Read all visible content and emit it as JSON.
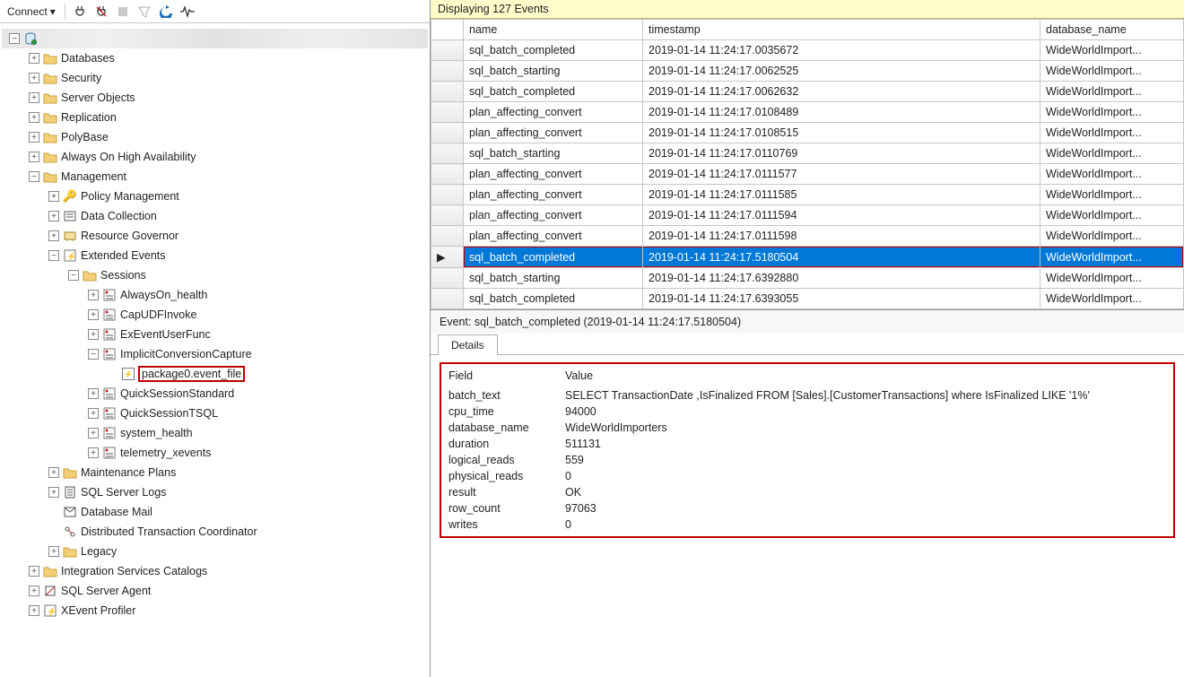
{
  "toolbar": {
    "connect_label": "Connect",
    "icons": [
      "plug",
      "plug-x",
      "stop",
      "filter",
      "refresh",
      "pulse"
    ]
  },
  "tree": {
    "root_label": ".\\",
    "nodes": [
      {
        "level": 0,
        "exp": "-",
        "icon": "db",
        "label": ".\\",
        "blur": true
      },
      {
        "level": 1,
        "exp": "+",
        "icon": "folder",
        "label": "Databases"
      },
      {
        "level": 1,
        "exp": "+",
        "icon": "folder",
        "label": "Security"
      },
      {
        "level": 1,
        "exp": "+",
        "icon": "folder",
        "label": "Server Objects"
      },
      {
        "level": 1,
        "exp": "+",
        "icon": "folder",
        "label": "Replication"
      },
      {
        "level": 1,
        "exp": "+",
        "icon": "folder",
        "label": "PolyBase"
      },
      {
        "level": 1,
        "exp": "+",
        "icon": "folder",
        "label": "Always On High Availability"
      },
      {
        "level": 1,
        "exp": "-",
        "icon": "folder",
        "label": "Management"
      },
      {
        "level": 2,
        "exp": "+",
        "icon": "policy",
        "label": "Policy Management"
      },
      {
        "level": 2,
        "exp": "+",
        "icon": "datacoll",
        "label": "Data Collection"
      },
      {
        "level": 2,
        "exp": "+",
        "icon": "resgov",
        "label": "Resource Governor"
      },
      {
        "level": 2,
        "exp": "-",
        "icon": "xe",
        "label": "Extended Events"
      },
      {
        "level": 3,
        "exp": "-",
        "icon": "folder",
        "label": "Sessions"
      },
      {
        "level": 4,
        "exp": "+",
        "icon": "xesession",
        "label": "AlwaysOn_health"
      },
      {
        "level": 4,
        "exp": "+",
        "icon": "xesession",
        "label": "CapUDFInvoke"
      },
      {
        "level": 4,
        "exp": "+",
        "icon": "xesession",
        "label": "ExEventUserFunc"
      },
      {
        "level": 4,
        "exp": "-",
        "icon": "xesession",
        "label": "ImplicitConversionCapture"
      },
      {
        "level": 5,
        "exp": " ",
        "icon": "pkg",
        "label": "package0.event_file",
        "redbox": true
      },
      {
        "level": 4,
        "exp": "+",
        "icon": "xesession",
        "label": "QuickSessionStandard"
      },
      {
        "level": 4,
        "exp": "+",
        "icon": "xesession",
        "label": "QuickSessionTSQL"
      },
      {
        "level": 4,
        "exp": "+",
        "icon": "xesession",
        "label": "system_health"
      },
      {
        "level": 4,
        "exp": "+",
        "icon": "xesession",
        "label": "telemetry_xevents"
      },
      {
        "level": 2,
        "exp": "+",
        "icon": "folder",
        "label": "Maintenance Plans"
      },
      {
        "level": 2,
        "exp": "+",
        "icon": "logs",
        "label": "SQL Server Logs"
      },
      {
        "level": 2,
        "exp": " ",
        "icon": "mail",
        "label": "Database Mail"
      },
      {
        "level": 2,
        "exp": " ",
        "icon": "dtc",
        "label": "Distributed Transaction Coordinator"
      },
      {
        "level": 2,
        "exp": "+",
        "icon": "folder",
        "label": "Legacy"
      },
      {
        "level": 1,
        "exp": "+",
        "icon": "folder",
        "label": "Integration Services Catalogs"
      },
      {
        "level": 1,
        "exp": "+",
        "icon": "agent",
        "label": "SQL Server Agent"
      },
      {
        "level": 1,
        "exp": "+",
        "icon": "xeprofiler",
        "label": "XEvent Profiler"
      }
    ]
  },
  "events": {
    "header": "Displaying 127 Events",
    "columns": [
      "name",
      "timestamp",
      "database_name"
    ],
    "selected_index": 10,
    "rows": [
      {
        "name": "sql_batch_completed",
        "timestamp": "2019-01-14 11:24:17.0035672",
        "database_name": "WideWorldImport..."
      },
      {
        "name": "sql_batch_starting",
        "timestamp": "2019-01-14 11:24:17.0062525",
        "database_name": "WideWorldImport..."
      },
      {
        "name": "sql_batch_completed",
        "timestamp": "2019-01-14 11:24:17.0062632",
        "database_name": "WideWorldImport..."
      },
      {
        "name": "plan_affecting_convert",
        "timestamp": "2019-01-14 11:24:17.0108489",
        "database_name": "WideWorldImport..."
      },
      {
        "name": "plan_affecting_convert",
        "timestamp": "2019-01-14 11:24:17.0108515",
        "database_name": "WideWorldImport..."
      },
      {
        "name": "sql_batch_starting",
        "timestamp": "2019-01-14 11:24:17.0110769",
        "database_name": "WideWorldImport..."
      },
      {
        "name": "plan_affecting_convert",
        "timestamp": "2019-01-14 11:24:17.0111577",
        "database_name": "WideWorldImport..."
      },
      {
        "name": "plan_affecting_convert",
        "timestamp": "2019-01-14 11:24:17.0111585",
        "database_name": "WideWorldImport..."
      },
      {
        "name": "plan_affecting_convert",
        "timestamp": "2019-01-14 11:24:17.0111594",
        "database_name": "WideWorldImport..."
      },
      {
        "name": "plan_affecting_convert",
        "timestamp": "2019-01-14 11:24:17.0111598",
        "database_name": "WideWorldImport..."
      },
      {
        "name": "sql_batch_completed",
        "timestamp": "2019-01-14 11:24:17.5180504",
        "database_name": "WideWorldImport..."
      },
      {
        "name": "sql_batch_starting",
        "timestamp": "2019-01-14 11:24:17.6392880",
        "database_name": "WideWorldImport..."
      },
      {
        "name": "sql_batch_completed",
        "timestamp": "2019-01-14 11:24:17.6393055",
        "database_name": "WideWorldImport..."
      }
    ]
  },
  "detail": {
    "header": "Event: sql_batch_completed (2019-01-14 11:24:17.5180504)",
    "tab": "Details",
    "field_header": "Field",
    "value_header": "Value",
    "rows": [
      {
        "field": "batch_text",
        "value": "SELECT TransactionDate      ,IsFinalized    FROM [Sales].[CustomerTransactions]  where IsFinalized  LIKE '1%'"
      },
      {
        "field": "cpu_time",
        "value": "94000"
      },
      {
        "field": "database_name",
        "value": "WideWorldImporters"
      },
      {
        "field": "duration",
        "value": "511131"
      },
      {
        "field": "logical_reads",
        "value": "559"
      },
      {
        "field": "physical_reads",
        "value": "0"
      },
      {
        "field": "result",
        "value": "OK"
      },
      {
        "field": "row_count",
        "value": "97063"
      },
      {
        "field": "writes",
        "value": "0"
      }
    ]
  }
}
